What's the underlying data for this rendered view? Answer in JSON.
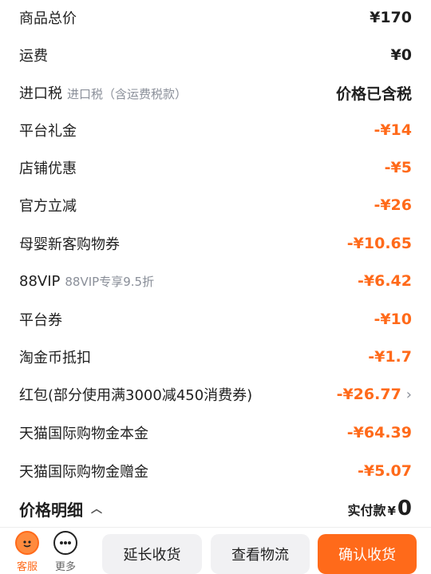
{
  "rows": [
    {
      "label": "商品总价",
      "sub": "",
      "value": "¥170",
      "type": "normal"
    },
    {
      "label": "运费",
      "sub": "",
      "value": "¥0",
      "type": "normal"
    },
    {
      "label": "进口税",
      "sub": "进口税（含运费税款）",
      "value": "价格已含税",
      "type": "normal"
    },
    {
      "label": "平台礼金",
      "sub": "",
      "value": "-¥14",
      "type": "discount"
    },
    {
      "label": "店铺优惠",
      "sub": "",
      "value": "-¥5",
      "type": "discount"
    },
    {
      "label": "官方立减",
      "sub": "",
      "value": "-¥26",
      "type": "discount"
    },
    {
      "label": "母婴新客购物券",
      "sub": "",
      "value": "-¥10.65",
      "type": "discount"
    },
    {
      "label": "88VIP",
      "sub": "88VIP专享9.5折",
      "value": "-¥6.42",
      "type": "discount"
    },
    {
      "label": "平台券",
      "sub": "",
      "value": "-¥10",
      "type": "discount"
    },
    {
      "label": "淘金币抵扣",
      "sub": "",
      "value": "-¥1.7",
      "type": "discount"
    },
    {
      "label": "红包(部分使用满3000减450消费券)",
      "sub": "",
      "value": "-¥26.77",
      "type": "discount",
      "chevron": "›"
    },
    {
      "label": "天猫国际购物金本金",
      "sub": "",
      "value": "-¥64.39",
      "type": "discount"
    },
    {
      "label": "天猫国际购物金赠金",
      "sub": "",
      "value": "-¥5.07",
      "type": "discount"
    }
  ],
  "summary": {
    "title": "价格明细",
    "caret": "^",
    "paid_label": "实付款",
    "currency": "¥",
    "amount": "0"
  },
  "bottom": {
    "service_label": "客服",
    "more_label": "更多",
    "extend_label": "延长收货",
    "logistics_label": "查看物流",
    "confirm_label": "确认收货"
  },
  "colors": {
    "accent": "#ff6a1a",
    "muted": "#8a8f99"
  },
  "icons": {
    "service": "service-face-icon",
    "more": "more-dots-icon",
    "chevron": "chevron-right-icon",
    "caret": "chevron-up-icon"
  }
}
